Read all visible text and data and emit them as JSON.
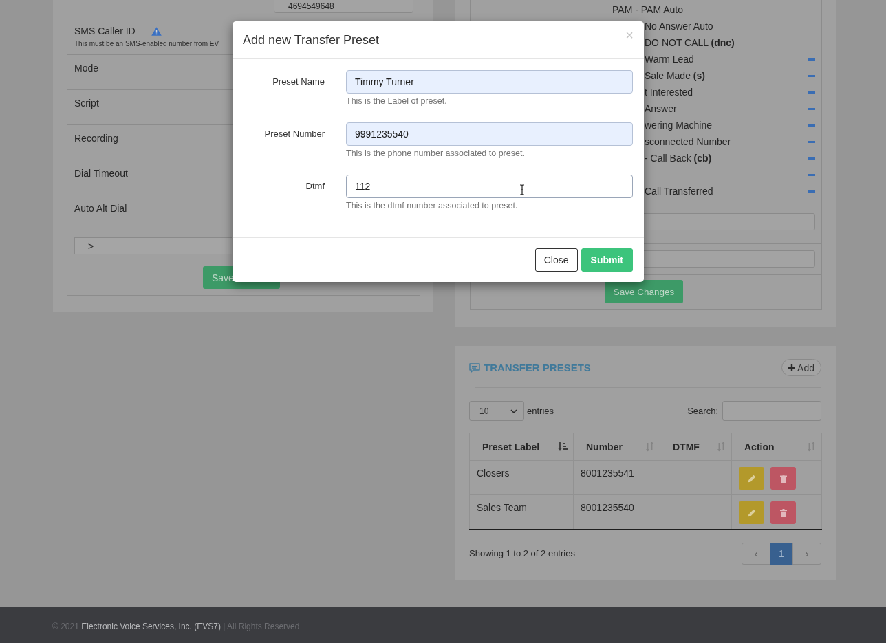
{
  "settings_card": {
    "rows": [
      {
        "kind": "field",
        "value": "4694549648"
      },
      {
        "kind": "label",
        "label": "SMS Caller ID",
        "warning": true,
        "help": "This must be an SMS-enabled number from EV"
      },
      {
        "kind": "label",
        "label": "Mode",
        "warning": false
      },
      {
        "kind": "label",
        "label": "Script",
        "warning": false
      },
      {
        "kind": "label",
        "label": "Recording",
        "warning": false
      },
      {
        "kind": "label",
        "label": "Dial Timeout",
        "warning": false
      },
      {
        "kind": "label",
        "label": "Auto Alt Dial",
        "warning": false
      },
      {
        "kind": "toggle",
        "label": ">"
      }
    ],
    "save_button": "Save"
  },
  "dispositions_card": {
    "statuses": [
      {
        "label": "PAM - PAM Auto",
        "removable": false
      },
      {
        "label": "No Answer Auto",
        "removable": false
      },
      {
        "label": "DO NOT CALL **(dnc)**",
        "removable": false
      },
      {
        "label": "Warm Lead",
        "removable": true
      },
      {
        "label": "Sale Made **(s)**",
        "removable": true
      },
      {
        "label": "t Interested",
        "removable": true
      },
      {
        "label": "Answer",
        "removable": true
      },
      {
        "label": "wering Machine",
        "removable": true
      },
      {
        "label": "sconnected Number",
        "removable": true
      },
      {
        "label": "- Call Back **(cb)**",
        "removable": true
      },
      {
        "removable": true
      },
      {
        "label": "Call Transferred",
        "removable": true
      }
    ],
    "rows": [
      {
        "kind": "input"
      },
      {
        "kind": "input"
      }
    ],
    "save_button": "Save Changes"
  },
  "transfer_presets": {
    "title": "TRANSFER PRESETS",
    "add_button": "Add",
    "page_size": "10",
    "page_size_label": "entries",
    "search_label": "Search:",
    "table": {
      "columns": [
        {
          "label": "Preset Label",
          "sorted": true
        },
        {
          "label": "Number",
          "sorted": false
        },
        {
          "label": "DTMF",
          "sorted": false
        },
        {
          "label": "Action",
          "sorted": false
        }
      ],
      "rows": [
        {
          "label": "Closers",
          "number": "8001235541"
        },
        {
          "label": "Sales Team",
          "number": "8001235540"
        }
      ]
    },
    "info": "Showing 1 to 2 of 2 entries",
    "pagination": [
      {
        "kind": "prev",
        "label": "‹",
        "selected": false
      },
      {
        "kind": "page",
        "label": "1",
        "selected": true
      },
      {
        "kind": "next",
        "label": "›",
        "selected": false
      }
    ]
  },
  "modal": {
    "title": "Add new Transfer Preset",
    "close": "×",
    "fields": [
      {
        "label": "Preset Name",
        "value": "Timmy Turner",
        "help": "This is the Label of preset.",
        "autofilled": true
      },
      {
        "label": "Preset Number",
        "value": "9991235540",
        "help": "This is the phone number associated to preset.",
        "autofilled": true
      },
      {
        "label": "Dtmf",
        "value": "112",
        "help": "This is the dtmf number associated to preset.",
        "autofilled": false
      }
    ],
    "buttons": [
      {
        "label": "Close",
        "kind": "default"
      },
      {
        "label": "Submit",
        "kind": "primary"
      }
    ]
  },
  "footer": {
    "prefix": "© 2021",
    "company": "Electronic Voice Services, Inc. (EVS7)",
    "suffix": "| All Rights Reserved"
  }
}
